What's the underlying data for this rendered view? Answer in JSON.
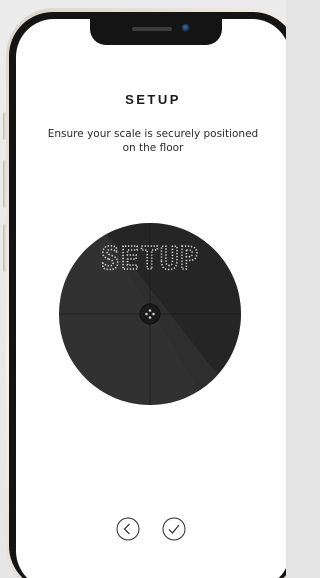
{
  "screen": {
    "title": "SETUP",
    "instruction": "Ensure your scale is securely positioned on the floor"
  },
  "scale": {
    "display_text": "SETUP",
    "center_icon": "brand-logo-icon"
  },
  "navigation": {
    "back_icon": "chevron-left-circle-icon",
    "confirm_icon": "checkmark-circle-icon"
  },
  "colors": {
    "scale_body": "#2c2c2c",
    "scale_highlight": "#4a4a4a",
    "display_dots": "#d8d8d8",
    "screen_background": "#ffffff",
    "text": "#1a1a1a"
  }
}
